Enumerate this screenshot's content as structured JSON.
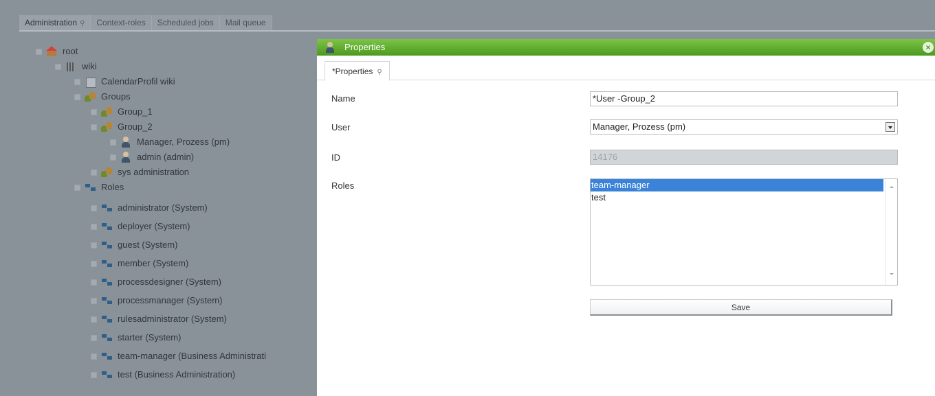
{
  "top_tabs": [
    {
      "label": "Administration",
      "active": true
    },
    {
      "label": "Context-roles",
      "active": false
    },
    {
      "label": "Scheduled jobs",
      "active": false
    },
    {
      "label": "Mail queue",
      "active": false
    }
  ],
  "tree": {
    "nodes": [
      {
        "label": "root",
        "icon": "home-icon"
      },
      {
        "label": "wiki",
        "icon": "building-icon"
      },
      {
        "label": "CalendarProfil wiki",
        "icon": "calendar-icon"
      },
      {
        "label": "Groups",
        "icon": "group-icon"
      },
      {
        "label": "Group_1",
        "icon": "group-icon"
      },
      {
        "label": "Group_2",
        "icon": "group-icon"
      },
      {
        "label": "Manager, Prozess (pm)",
        "icon": "user-icon"
      },
      {
        "label": "admin (admin)",
        "icon": "user-icon"
      },
      {
        "label": "sys administration",
        "icon": "group-icon"
      },
      {
        "label": "Roles",
        "icon": "role-icon"
      },
      {
        "label": "administrator (System)",
        "icon": "role-icon"
      },
      {
        "label": "deployer (System)",
        "icon": "role-icon"
      },
      {
        "label": "guest (System)",
        "icon": "role-icon"
      },
      {
        "label": "member (System)",
        "icon": "role-icon"
      },
      {
        "label": "processdesigner (System)",
        "icon": "role-icon"
      },
      {
        "label": "processmanager (System)",
        "icon": "role-icon"
      },
      {
        "label": "rulesadministrator (System)",
        "icon": "role-icon"
      },
      {
        "label": "starter (System)",
        "icon": "role-icon"
      },
      {
        "label": "team-manager (Business Administrati",
        "icon": "role-icon"
      },
      {
        "label": "test (Business Administration)",
        "icon": "role-icon"
      }
    ]
  },
  "dialog": {
    "title": "Properties",
    "close_icon": "close-icon",
    "tab_label": "*Properties",
    "name_label": "Name",
    "name_value": "*User -Group_2",
    "user_label": "User",
    "user_value": "Manager, Prozess (pm)",
    "id_label": "ID",
    "id_value": "14176",
    "roles_label": "Roles",
    "roles": [
      "team-manager",
      "test"
    ],
    "selected_role": "team-manager",
    "save_label": "Save"
  },
  "colors": {
    "title_bar": "#5fae2c",
    "selection": "#3a83d8",
    "overlay": "#8a9299"
  }
}
